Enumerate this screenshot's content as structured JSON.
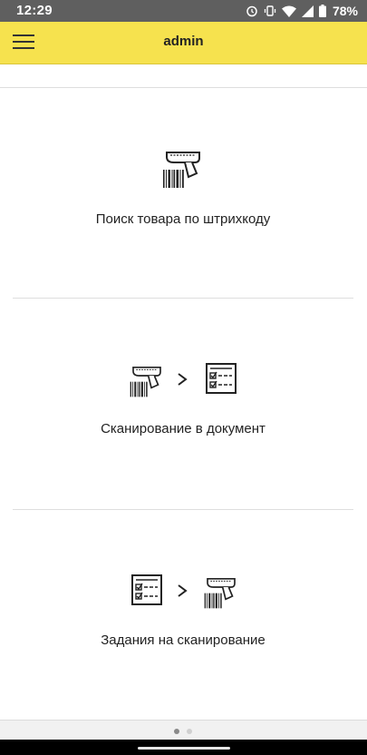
{
  "status_bar": {
    "time": "12:29",
    "battery": "78%",
    "icons": [
      "alarm-icon",
      "vibrate-icon",
      "wifi-icon",
      "signal-icon",
      "battery-icon"
    ]
  },
  "toolbar": {
    "title": "admin",
    "menu_icon": "hamburger-menu-icon"
  },
  "cards": [
    {
      "label": "Поиск товара по штрихкоду",
      "icons": [
        "barcode-scanner-icon"
      ]
    },
    {
      "label": "Сканирование в документ",
      "icons": [
        "barcode-scanner-icon",
        "chevron-right-icon",
        "document-checklist-icon"
      ]
    },
    {
      "label": "Задания на сканирование",
      "icons": [
        "document-checklist-icon",
        "chevron-right-icon",
        "barcode-scanner-icon"
      ]
    }
  ],
  "pager": {
    "pages": 2,
    "active": 1
  },
  "colors": {
    "toolbar": "#f6e24e",
    "status_bar": "#5f5f5f",
    "text": "#222222"
  }
}
